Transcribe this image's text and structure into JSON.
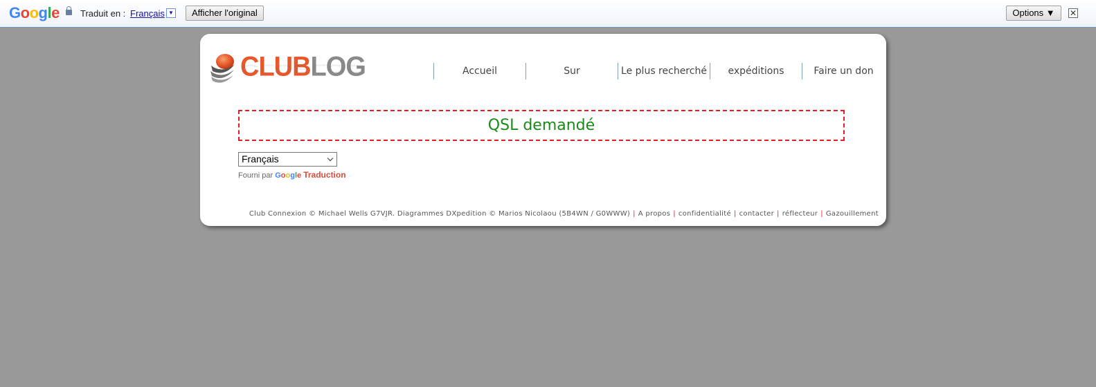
{
  "translate_bar": {
    "logo_letters": [
      "G",
      "o",
      "o",
      "g",
      "l",
      "e"
    ],
    "label": "Traduit en :",
    "language": "Français",
    "show_original": "Afficher l'original",
    "options": "Options ▼",
    "close": "✕"
  },
  "brand": {
    "club": "CLUB",
    "log": "LOG"
  },
  "nav": {
    "items": [
      {
        "label": "Accueil"
      },
      {
        "label": "Sur"
      },
      {
        "label": "Le plus recherché"
      },
      {
        "label": "expéditions"
      },
      {
        "label": "Faire un don"
      }
    ]
  },
  "main": {
    "status": "QSL demandé",
    "language_select": "Français",
    "powered_by": "Fourni par",
    "powered_google": [
      "G",
      "o",
      "o",
      "g",
      "l",
      "e"
    ],
    "powered_service": "Traduction"
  },
  "footer": {
    "copyright": "Club Connexion © Michael Wells G7VJR. Diagrammes DXpedition © Marios Nicolaou (5B4WN / G0WWW)",
    "links": [
      "A propos",
      "confidentialité",
      "contacter",
      "réflecteur",
      "Gazouillement"
    ]
  },
  "colors": {
    "accent_orange": "#e8582a",
    "status_green": "#1a8a1a",
    "dashed_red": "#e31b23",
    "page_background": "#999999"
  }
}
